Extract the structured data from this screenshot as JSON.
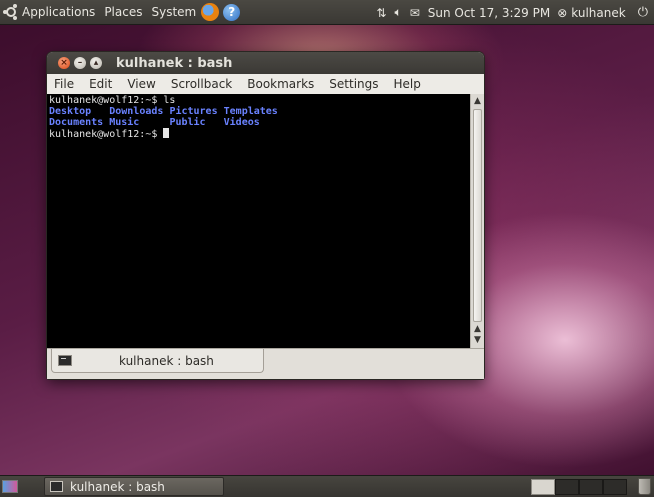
{
  "top_panel": {
    "menus": [
      "Applications",
      "Places",
      "System"
    ],
    "clock": "Sun Oct 17,  3:29 PM",
    "username": "kulhanek"
  },
  "window": {
    "title": "kulhanek : bash",
    "menu": [
      "File",
      "Edit",
      "View",
      "Scrollback",
      "Bookmarks",
      "Settings",
      "Help"
    ],
    "terminal": {
      "prompt": "kulhanek@wolf12:~$ ",
      "command": "ls",
      "dir_rows": [
        [
          "Desktop  ",
          "Downloads",
          "Pictures",
          "Templates"
        ],
        [
          "Documents",
          "Music    ",
          "Public  ",
          "Videos"
        ]
      ]
    },
    "tab_label": "kulhanek : bash"
  },
  "bottom_panel": {
    "task_label": "kulhanek : bash"
  },
  "colors": {
    "directory": "#6a82ff",
    "close_button": "#dd4814",
    "panel": "#3a3834"
  }
}
